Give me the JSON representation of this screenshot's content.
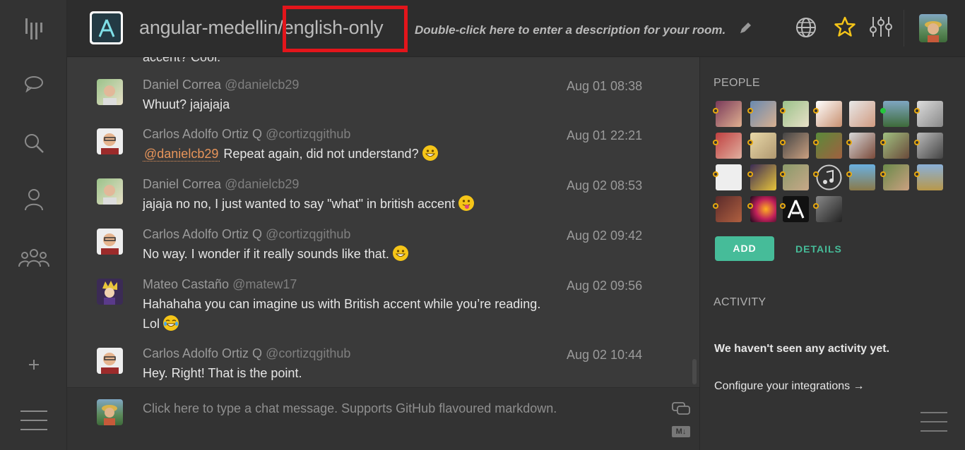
{
  "header": {
    "room_org": "angular-medellin",
    "room_sep": "/",
    "room_name": "english-only",
    "description_placeholder": "Double-click here to enter a description for your room."
  },
  "chat": {
    "cut_text": "accent? Cool.",
    "messages": [
      {
        "name": "Daniel Correa",
        "handle": "@danielcb29",
        "time": "Aug 01 08:38",
        "text": "Whuut? jajajaja"
      },
      {
        "name": "Carlos Adolfo Ortiz Q",
        "handle": "@cortizqgithub",
        "time": "Aug 01 22:21",
        "mention": "@danielcb29",
        "text": " Repeat again, did not understand? "
      },
      {
        "name": "Daniel Correa",
        "handle": "@danielcb29",
        "time": "Aug 02 08:53",
        "text": "jajaja no no, I just wanted to say \"what\" in british accent "
      },
      {
        "name": "Carlos Adolfo Ortiz Q",
        "handle": "@cortizqgithub",
        "time": "Aug 02 09:42",
        "text": "No way. I wonder if it really sounds like that. "
      },
      {
        "name": "Mateo Castaño",
        "handle": "@matew17",
        "time": "Aug 02 09:56",
        "text": "Hahahaha you can imagine us with British accent while you’re reading.",
        "text2": "Lol "
      },
      {
        "name": "Carlos Adolfo Ortiz Q",
        "handle": "@cortizqgithub",
        "time": "Aug 02 10:44",
        "text": "Hey. Right! That is the point."
      }
    ],
    "input_placeholder": "Click here to type a chat message. Supports GitHub flavoured markdown.",
    "markdown_badge": "M↓"
  },
  "panel": {
    "people_title": "PEOPLE",
    "add_label": "ADD",
    "details_label": "DETAILS",
    "activity_title": "ACTIVITY",
    "activity_empty": "We haven't seen any activity yet.",
    "integrations_link": "Configure your integrations →"
  },
  "colors": {
    "accent": "#46bc99",
    "highlight_box": "#e3151b",
    "mention": "#e8955a",
    "star": "#f5c518",
    "away_dot": "#e8a90f",
    "online_dot": "#25c53c"
  },
  "icons": {
    "rail": [
      "gitter-logo-icon",
      "chat-bubble-icon",
      "search-icon",
      "person-icon",
      "group-icon",
      "plus-icon",
      "menu-icon"
    ],
    "header": [
      "globe-icon",
      "star-icon",
      "settings-sliders-icon",
      "pencil-icon"
    ]
  }
}
